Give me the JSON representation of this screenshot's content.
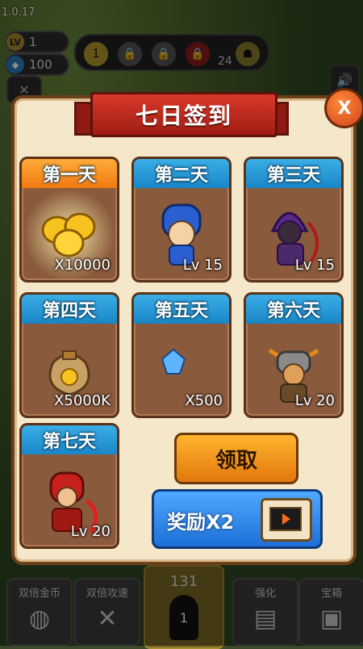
{
  "version": "1.0.17",
  "hud": {
    "level_badge": "LV",
    "level": "1",
    "gems": "100",
    "stage_current": "1",
    "stage_count": "24"
  },
  "modal": {
    "title": "七日签到",
    "close_label": "X",
    "days": [
      {
        "head": "第一天",
        "label": "X10000",
        "reward": "gold-coins",
        "today": true
      },
      {
        "head": "第二天",
        "label": "Lv 15",
        "reward": "blue-hooded-hero"
      },
      {
        "head": "第三天",
        "label": "Lv 15",
        "reward": "purple-hooded-hero"
      },
      {
        "head": "第四天",
        "label": "X5000K",
        "reward": "gold-bag"
      },
      {
        "head": "第五天",
        "label": "X500",
        "reward": "blue-gem"
      },
      {
        "head": "第六天",
        "label": "Lv 20",
        "reward": "horned-helmet-hero"
      },
      {
        "head": "第七天",
        "label": "Lv 20",
        "reward": "red-armor-hero"
      }
    ],
    "claim_button": "领取",
    "double_button": "奖励X2"
  },
  "bottom": {
    "double_gold": "双倍金币",
    "double_speed": "双倍攻速",
    "center_count": "131",
    "center_level": "1",
    "upgrade": "强化",
    "chest": "宝箱"
  },
  "colors": {
    "modal_bg": "#f5e7c9",
    "card_bg": "#8a5a3c",
    "day_head": "#1a86c6",
    "today_head": "#f07a10",
    "claim": "#e2780d",
    "double": "#1d6fd6"
  }
}
